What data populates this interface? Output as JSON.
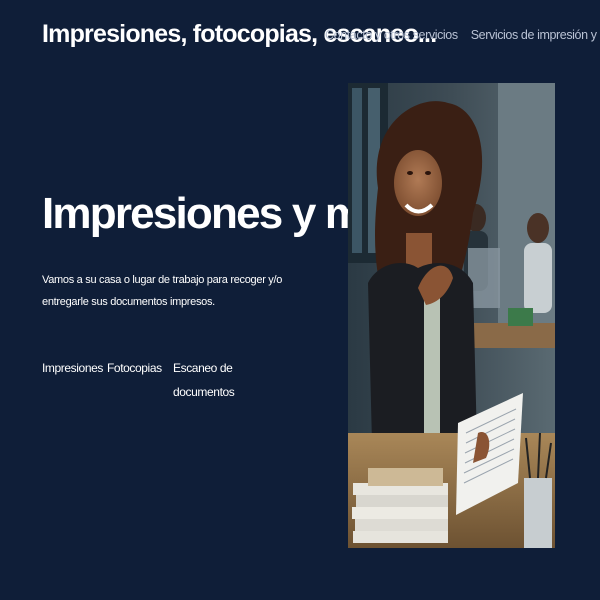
{
  "header": {
    "site_title": "Impresiones, fotocopias, escaneo...",
    "nav": [
      {
        "label": "Contacto y otros servicios"
      },
      {
        "label": "Servicios de impresión y más"
      }
    ]
  },
  "hero": {
    "heading": "Impresiones y más...",
    "description": "Vamos a su casa o lugar de trabajo para recoger y/o entregarle sus documentos impresos.",
    "services": [
      {
        "label": "Impresiones"
      },
      {
        "label": "Fotocopias"
      },
      {
        "label": "Escaneo de documentos"
      }
    ]
  },
  "colors": {
    "background": "#0f1e38",
    "text": "#ffffff",
    "nav_text": "#b9c2d4"
  }
}
